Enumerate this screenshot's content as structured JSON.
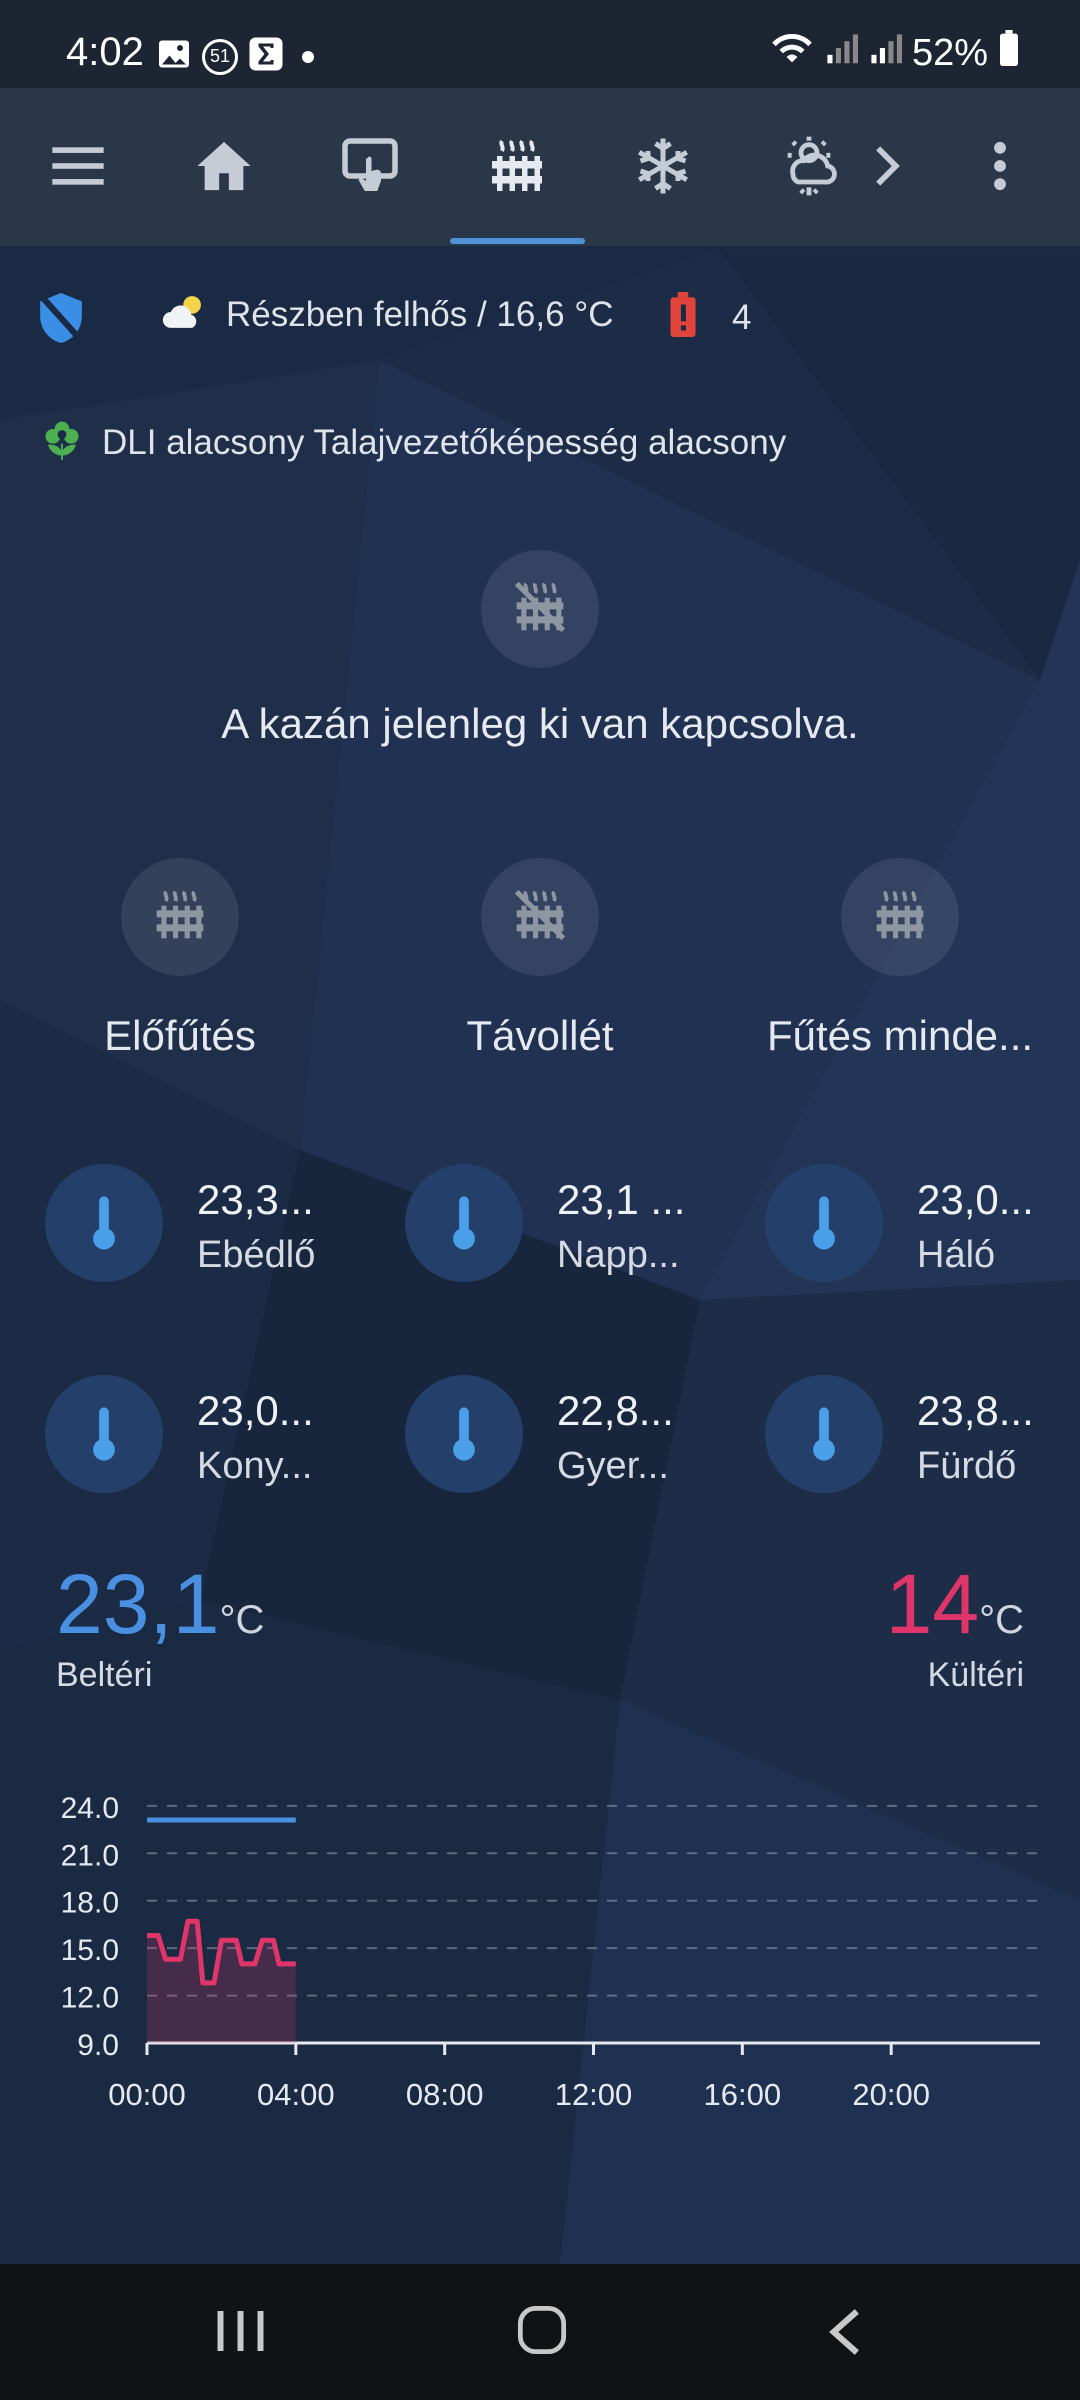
{
  "status_bar": {
    "time": "4:02",
    "battery": "52%",
    "notif_badge": "51"
  },
  "nav": {
    "tabs": [
      {
        "icon": "hamburger-menu-icon"
      },
      {
        "icon": "home-icon"
      },
      {
        "icon": "touch-screen-icon"
      },
      {
        "icon": "radiator-icon",
        "active": true
      },
      {
        "icon": "snowflake-icon"
      },
      {
        "icon": "weather-snow-icon"
      },
      {
        "icon": "chevron-right-icon"
      },
      {
        "icon": "more-vertical-icon"
      }
    ]
  },
  "badges": {
    "weather": "Részben felhős / 16,6 °C",
    "alerts_count": "4",
    "plant_status": "DLI alacsony Talajvezetőképesség alacsony"
  },
  "heating": {
    "boiler_message": "A kazán jelenleg ki van kapcsolva.",
    "modes": [
      "Előfűtés",
      "Távollét",
      "Fűtés minde..."
    ]
  },
  "sensors": [
    {
      "value": "23,3...",
      "name": "Ebédlő"
    },
    {
      "value": "23,1 ...",
      "name": "Napp..."
    },
    {
      "value": "23,0...",
      "name": "Háló"
    },
    {
      "value": "23,0...",
      "name": "Kony..."
    },
    {
      "value": "22,8...",
      "name": "Gyer..."
    },
    {
      "value": "23,8...",
      "name": "Fürdő"
    }
  ],
  "temps": {
    "indoor_value": "23,1",
    "indoor_unit": "°C",
    "indoor_label": "Beltéri",
    "outdoor_value": "14",
    "outdoor_unit": "°C",
    "outdoor_label": "Kültéri"
  },
  "colors": {
    "indoor": "#4a90e2",
    "outdoor": "#e0356b",
    "accent": "#4f93d6"
  },
  "chart_data": {
    "type": "line",
    "x_ticks": [
      "00:00",
      "04:00",
      "08:00",
      "12:00",
      "16:00",
      "20:00"
    ],
    "y_ticks": [
      "24.0",
      "21.0",
      "18.0",
      "15.0",
      "12.0",
      "9.0"
    ],
    "ylim": [
      9,
      25
    ],
    "xlim_hours": [
      0,
      24
    ],
    "grid": true,
    "series": [
      {
        "name": "Beltéri",
        "color": "#4a90e2",
        "points": [
          [
            0,
            23.1
          ],
          [
            4,
            23.1
          ]
        ]
      },
      {
        "name": "Kültéri",
        "color": "#e0356b",
        "fill": true,
        "points": [
          [
            0,
            15.8
          ],
          [
            0.3,
            15.8
          ],
          [
            0.5,
            14.3
          ],
          [
            0.9,
            14.3
          ],
          [
            1.1,
            16.7
          ],
          [
            1.35,
            16.7
          ],
          [
            1.5,
            12.8
          ],
          [
            1.8,
            12.8
          ],
          [
            2.0,
            15.5
          ],
          [
            2.4,
            15.5
          ],
          [
            2.55,
            14.0
          ],
          [
            2.9,
            14.0
          ],
          [
            3.1,
            15.5
          ],
          [
            3.4,
            15.5
          ],
          [
            3.55,
            14.0
          ],
          [
            4.0,
            14.0
          ]
        ]
      }
    ]
  }
}
